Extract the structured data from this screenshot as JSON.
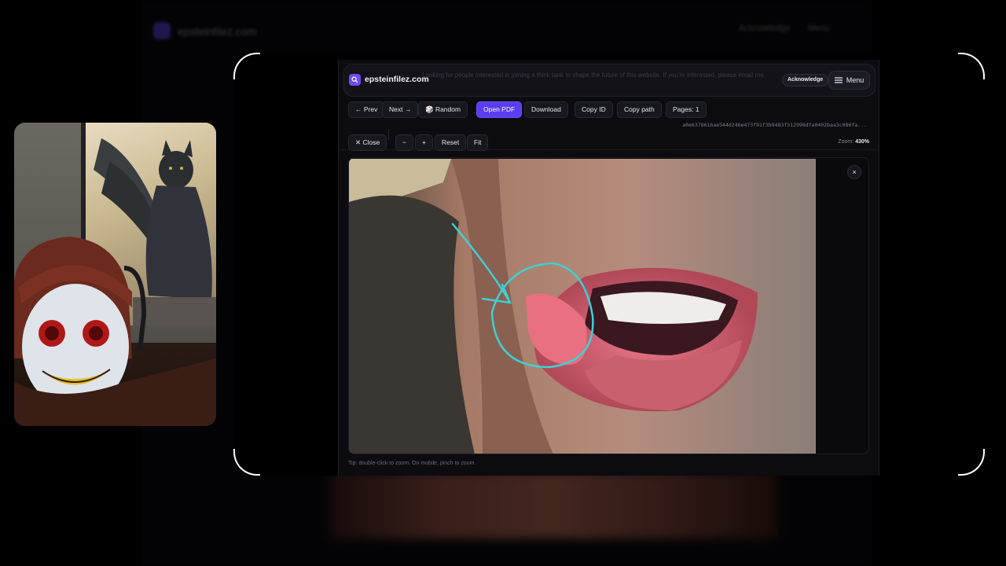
{
  "background_page": {
    "site": "epsteinfilez.com",
    "header_button_1": "Acknowledge",
    "header_button_2": "Menu"
  },
  "topbar": {
    "site_name": "epsteinfilez.com",
    "notice": "Looking for people interested in joining a think tank to shape the future of this website. If you're interested, please email me.",
    "acknowledge_label": "Acknowledge",
    "menu_label": "Menu"
  },
  "toolbar": {
    "prev_label": "← Prev",
    "next_label": "Next →",
    "random_label": "🎲 Random",
    "open_pdf_label": "Open PDF",
    "download_label": "Download",
    "copy_id_label": "Copy ID",
    "copy_path_label": "Copy path",
    "pages_label": "Pages: 1"
  },
  "document": {
    "hash": "a0e6378616ae544d246e473f91f3b9483f312998dfa0402baa3c086fa..."
  },
  "viewer_controls": {
    "close_label": "✕ Close",
    "zoom_out_label": "−",
    "zoom_in_label": "+",
    "reset_label": "Reset",
    "fit_label": "Fit",
    "zoom_prefix": "Zoom: ",
    "zoom_value": "430%"
  },
  "viewer": {
    "close_icon_label": "×",
    "tip": "Tip: double-click to zoom. On mobile, pinch to zoom."
  },
  "colors": {
    "accent": "#5a3df0",
    "annotation": "#3fd0d4",
    "background": "#0b0b10"
  },
  "icons": [
    "search-icon",
    "hamburger-menu-icon",
    "dice-icon",
    "close-icon"
  ]
}
